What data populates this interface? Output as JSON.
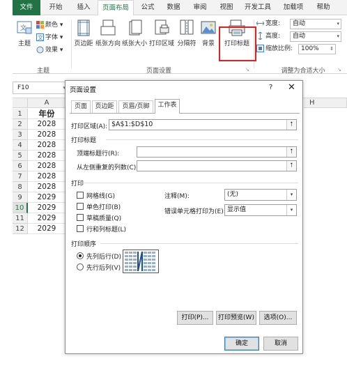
{
  "ribbon": {
    "tabs": [
      "文件",
      "开始",
      "插入",
      "页面布局",
      "公式",
      "数据",
      "审阅",
      "视图",
      "开发工具",
      "加载项",
      "帮助"
    ],
    "active_tab": "页面布局",
    "themes_group": {
      "themes_label": "主题",
      "colors_label": "颜色",
      "fonts_label": "字体",
      "effects_label": "效果",
      "group_label": "主题"
    },
    "page_setup_group": {
      "margins_label": "页边距",
      "orientation_label": "纸张方向",
      "size_label": "纸张大小",
      "print_area_label": "打印区域",
      "breaks_label": "分隔符",
      "background_label": "背景",
      "print_titles_label": "打印标题",
      "group_label": "页面设置"
    },
    "scale_group": {
      "width_label": "宽度:",
      "width_value": "自动",
      "height_label": "高度:",
      "height_value": "自动",
      "scale_label": "缩放比例:",
      "scale_value": "100%",
      "group_label": "调整为合适大小"
    }
  },
  "sheet": {
    "name_box": "F10",
    "column_a": "A",
    "column_h": "H",
    "selected_row": "10",
    "rows": [
      {
        "num": "1",
        "value": "年份"
      },
      {
        "num": "2",
        "value": "2028"
      },
      {
        "num": "3",
        "value": "2028"
      },
      {
        "num": "4",
        "value": "2028"
      },
      {
        "num": "5",
        "value": "2028"
      },
      {
        "num": "6",
        "value": "2028"
      },
      {
        "num": "7",
        "value": "2028"
      },
      {
        "num": "8",
        "value": "2028"
      },
      {
        "num": "9",
        "value": "2029"
      },
      {
        "num": "10",
        "value": "2029"
      },
      {
        "num": "11",
        "value": "2029"
      },
      {
        "num": "12",
        "value": "2029"
      }
    ]
  },
  "dialog": {
    "title": "页面设置",
    "help": "?",
    "close": "✕",
    "tabs": [
      "页面",
      "页边距",
      "页眉/页脚",
      "工作表"
    ],
    "active_tab": "工作表",
    "print_area_label": "打印区域(A):",
    "print_area_value": "$A$1:$D$10",
    "print_titles_section": "打印标题",
    "rows_repeat_label": "顶端标题行(R):",
    "rows_repeat_value": "",
    "cols_repeat_label": "从左侧重复的列数(C):",
    "cols_repeat_value": "",
    "print_section": "打印",
    "gridlines_label": "网格线(G)",
    "bw_label": "单色打印(B)",
    "draft_label": "草稿质量(Q)",
    "headings_label": "行和列标题(L)",
    "comments_label": "注释(M):",
    "comments_value": "(无)",
    "errors_label": "错误单元格打印为(E):",
    "errors_value": "显示值",
    "order_section": "打印顺序",
    "down_then_over_label": "先列后行(D)",
    "over_then_down_label": "先行后列(V)",
    "print_button": "打印(P)...",
    "preview_button": "打印预览(W)",
    "options_button": "选项(O)...",
    "ok_button": "确定",
    "cancel_button": "取消"
  },
  "colors": {
    "excel_green": "#217346",
    "highlight_red": "#e02020"
  }
}
